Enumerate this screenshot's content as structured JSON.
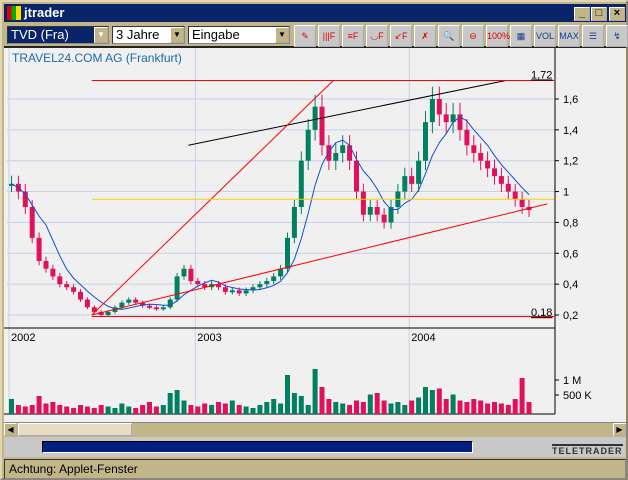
{
  "window": {
    "title": "jtrader"
  },
  "toolbar": {
    "symbol": "TVD (Fra)",
    "period": "3 Jahre",
    "mode": "Eingabe",
    "buttons": [
      {
        "name": "pencil",
        "label": "✎"
      },
      {
        "name": "vertical-lines",
        "label": "|||F"
      },
      {
        "name": "horizontal-lines",
        "label": "≡F"
      },
      {
        "name": "arcs",
        "label": "◡F"
      },
      {
        "name": "fan",
        "label": "↙F"
      },
      {
        "name": "delete-drawing",
        "label": "✗"
      },
      {
        "name": "zoom-in",
        "label": "🔍"
      },
      {
        "name": "zoom-out",
        "label": "⊖"
      },
      {
        "name": "zoom-100",
        "label": "100%"
      },
      {
        "name": "grid",
        "label": "▦"
      },
      {
        "name": "volume",
        "label": "VOL"
      },
      {
        "name": "max-min",
        "label": "MAX MIN"
      },
      {
        "name": "comment",
        "label": "☰"
      },
      {
        "name": "chart-type",
        "label": "↯"
      }
    ]
  },
  "chart_data": {
    "type": "candlestick",
    "title": "TRAVEL24.COM AG (Frankfurt)",
    "x_ticks": [
      {
        "label": "2002",
        "i": 0
      },
      {
        "label": "2003",
        "i": 27
      },
      {
        "label": "2004",
        "i": 58
      }
    ],
    "y_ticks": [
      0.2,
      0.4,
      0.6,
      0.8,
      1,
      1.2,
      1.4,
      1.6
    ],
    "ylim": [
      0.15,
      1.78
    ],
    "max_label": "1,72",
    "min_label": "0,18",
    "max": 1.72,
    "min": 0.18,
    "closes": [
      1.05,
      1.0,
      0.9,
      0.7,
      0.55,
      0.5,
      0.45,
      0.4,
      0.38,
      0.35,
      0.3,
      0.25,
      0.22,
      0.2,
      0.22,
      0.25,
      0.28,
      0.3,
      0.28,
      0.26,
      0.25,
      0.24,
      0.25,
      0.3,
      0.45,
      0.5,
      0.42,
      0.4,
      0.38,
      0.4,
      0.38,
      0.35,
      0.36,
      0.34,
      0.36,
      0.38,
      0.4,
      0.42,
      0.45,
      0.5,
      0.7,
      0.9,
      1.2,
      1.4,
      1.55,
      1.3,
      1.2,
      1.25,
      1.3,
      1.2,
      1.0,
      0.85,
      0.9,
      0.85,
      0.8,
      0.9,
      1.0,
      1.1,
      1.05,
      1.2,
      1.45,
      1.6,
      1.5,
      1.45,
      1.5,
      1.4,
      1.3,
      1.25,
      1.2,
      1.15,
      1.1,
      1.05,
      1.0,
      0.95,
      0.9,
      0.88
    ],
    "volumes": [
      500,
      300,
      250,
      300,
      600,
      350,
      400,
      300,
      250,
      200,
      300,
      250,
      200,
      300,
      250,
      200,
      350,
      250,
      200,
      300,
      400,
      250,
      300,
      700,
      800,
      450,
      300,
      250,
      350,
      300,
      400,
      350,
      450,
      300,
      250,
      200,
      300,
      400,
      500,
      350,
      1300,
      700,
      600,
      300,
      1500,
      900,
      500,
      400,
      350,
      300,
      450,
      400,
      650,
      700,
      450,
      350,
      400,
      300,
      450,
      550,
      900,
      800,
      850,
      500,
      650,
      450,
      400,
      500,
      450,
      350,
      400,
      350,
      300,
      500,
      1200,
      400
    ],
    "volume_ticks": [
      "1 M",
      "500 K"
    ],
    "drawings": [
      {
        "name": "black-trendline",
        "color": "#000000",
        "from": [
          26,
          1.3
        ],
        "to": [
          72,
          1.72
        ]
      },
      {
        "name": "red-rise-line",
        "color": "#ff0000",
        "from": [
          12,
          0.2
        ],
        "to": [
          47,
          1.72
        ]
      },
      {
        "name": "red-support-line",
        "color": "#ff0000",
        "from": [
          12,
          0.2
        ],
        "to": [
          78,
          0.92
        ]
      },
      {
        "name": "yellow-level",
        "color": "#ffcc00",
        "from": [
          12,
          0.95
        ],
        "to": [
          79,
          0.95
        ]
      },
      {
        "name": "max-line",
        "color": "#ff0000",
        "from": [
          12,
          1.72
        ],
        "to": [
          79,
          1.72
        ]
      },
      {
        "name": "min-line",
        "color": "#ff0000",
        "from": [
          12,
          0.19
        ],
        "to": [
          79,
          0.19
        ]
      }
    ]
  },
  "colors": {
    "up": "#008060",
    "down": "#e0105a",
    "ma": "#1050d0"
  },
  "status": "Achtung: Applet-Fenster",
  "logo": "TELETRADER"
}
